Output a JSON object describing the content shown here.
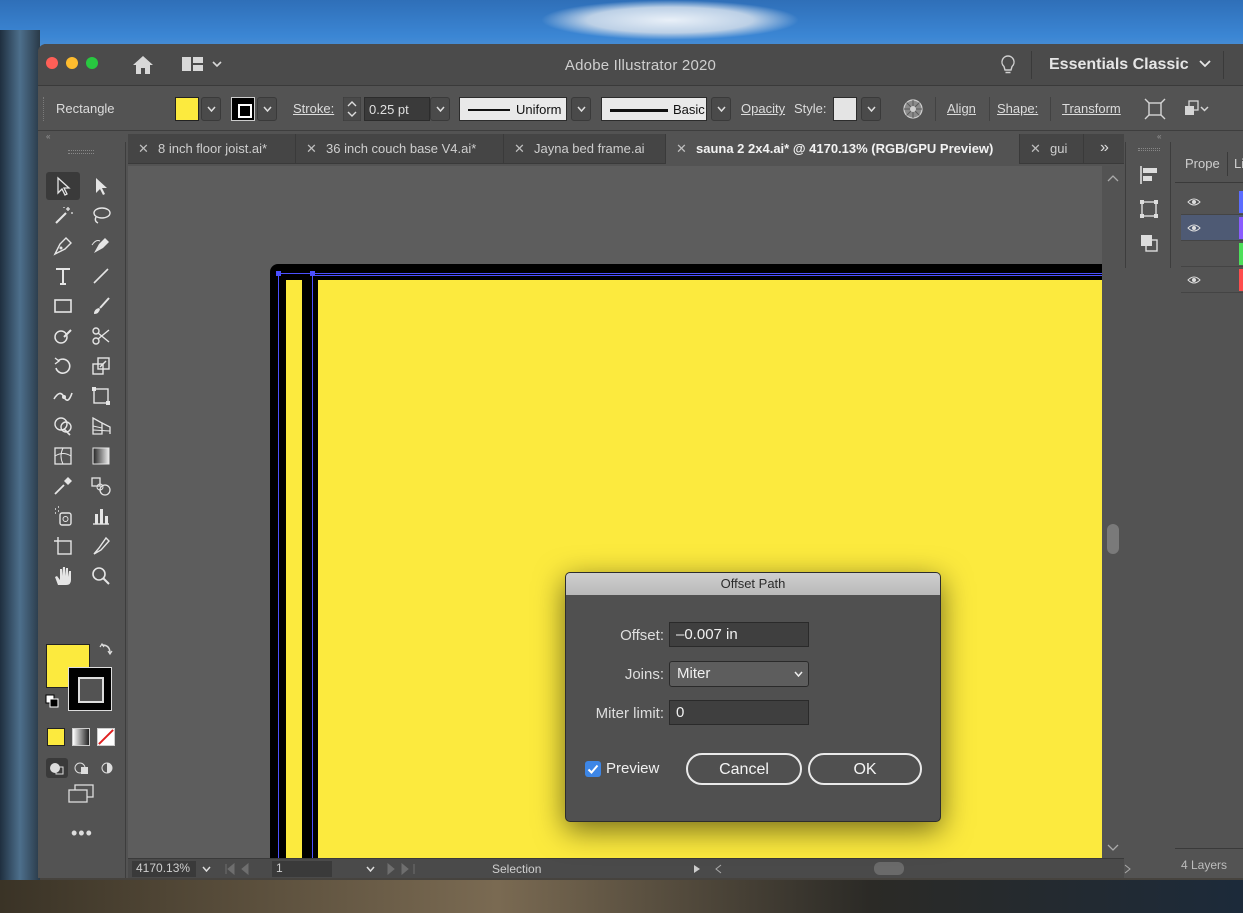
{
  "app": {
    "title": "Adobe Illustrator 2020",
    "workspace": "Essentials Classic"
  },
  "control_bar": {
    "selection_type": "Rectangle",
    "stroke_label": "Stroke:",
    "stroke_weight": "0.25 pt",
    "variable_width_profile": "Uniform",
    "brush_definition": "Basic",
    "opacity_label": "Opacity",
    "style_label": "Style:",
    "align_label": "Align",
    "shape_label": "Shape:",
    "transform_label": "Transform",
    "fill_color": "#fcea3e",
    "stroke_color": "#000000"
  },
  "tabs": [
    {
      "label": "8 inch floor joist.ai*"
    },
    {
      "label": "36 inch couch base V4.ai*"
    },
    {
      "label": "Jayna bed frame.ai"
    },
    {
      "label": "sauna 2 2x4.ai* @ 4170.13% (RGB/GPU Preview)"
    },
    {
      "label": "gui"
    }
  ],
  "status_bar": {
    "zoom": "4170.13%",
    "artboard": "1",
    "tool": "Selection"
  },
  "right_panel": {
    "tab_properties": "Prope",
    "tab_layers": "Li",
    "layers_count": "4 Layers",
    "layer_colors": [
      "#5b6cff",
      "#8a5cff",
      "#4de05a",
      "#ff4d4d"
    ]
  },
  "dialog": {
    "title": "Offset Path",
    "offset_label": "Offset:",
    "offset_value": "–0.007 in",
    "joins_label": "Joins:",
    "joins_value": "Miter",
    "miter_label": "Miter limit:",
    "miter_value": "0",
    "preview_label": "Preview",
    "preview_checked": true,
    "cancel_label": "Cancel",
    "ok_label": "OK"
  },
  "colors": {
    "artwork_fill": "#fcea3e",
    "selection": "#4b50ff",
    "accent": "#3d86e6"
  }
}
